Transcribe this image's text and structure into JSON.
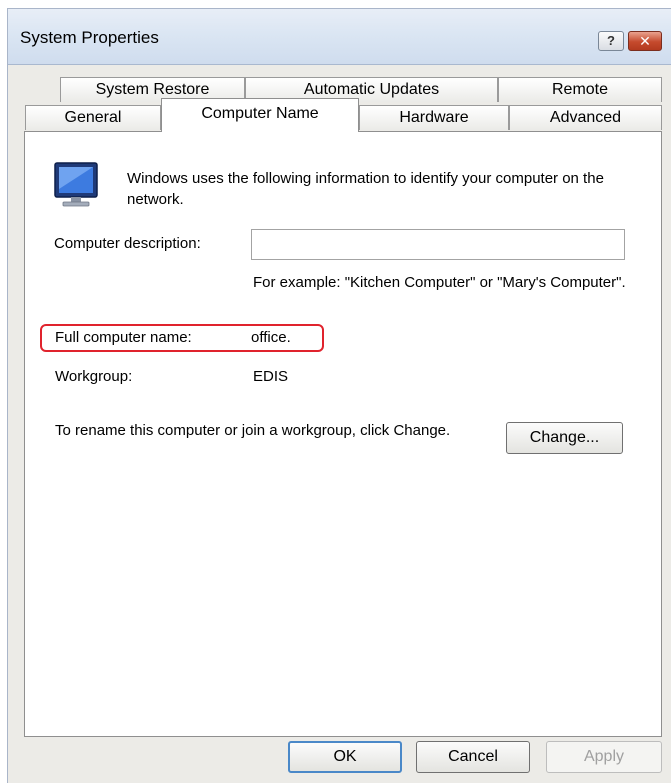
{
  "window": {
    "title": "System Properties",
    "help_glyph": "?",
    "close_glyph": "✕"
  },
  "tabs": {
    "row1": [
      "System Restore",
      "Automatic Updates",
      "Remote"
    ],
    "row2": [
      "General",
      "Computer Name",
      "Hardware",
      "Advanced"
    ],
    "selected": "Computer Name"
  },
  "computer_name": {
    "intro": "Windows uses the following information to identify your computer on the network.",
    "description_label": "Computer description:",
    "description_value": "",
    "example_text": "For example: \"Kitchen Computer\" or \"Mary's Computer\".",
    "full_name_label": "Full computer name:",
    "full_name_value": "office.",
    "workgroup_label": "Workgroup:",
    "workgroup_value": "EDIS",
    "rename_text": "To rename this computer or join a workgroup, click Change.",
    "change_button": "Change..."
  },
  "buttons": {
    "ok": "OK",
    "cancel": "Cancel",
    "apply": "Apply"
  },
  "colors": {
    "highlight": "#e0232d",
    "default_button_border": "#4a88c8"
  },
  "icons": {
    "computer": "computer-monitor-icon"
  }
}
